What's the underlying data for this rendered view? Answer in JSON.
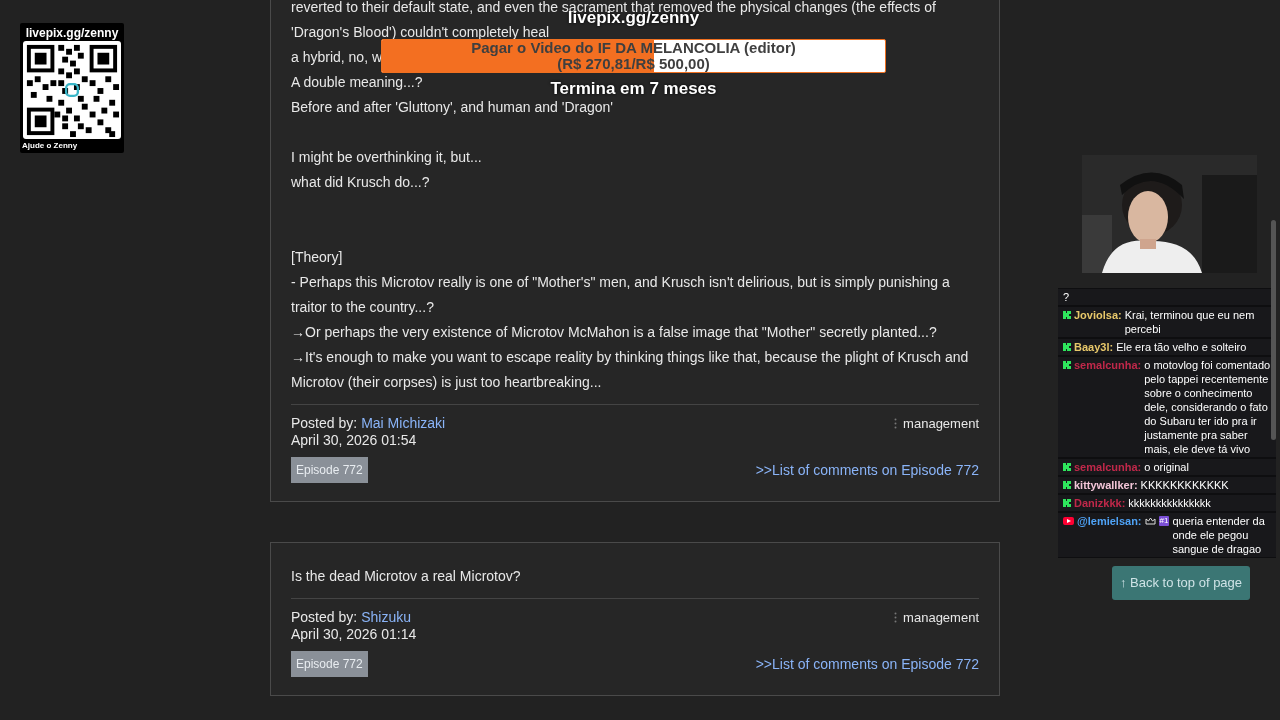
{
  "posts": [
    {
      "paragraphs": [
        {
          "kind": "lead",
          "lines": [
            "reverted to their default state, and even the sacrament that removed the physical changes (the effects of",
            "'Dragon's Blood') couldn't completely heal",
            "a hybrid, no, w",
            "A double meaning...?",
            "Before and after 'Gluttony', and human and 'Dragon'"
          ]
        },
        {
          "kind": "spaced",
          "lines": [
            "I might be overthinking it, but...",
            "what did Krusch do...?"
          ]
        },
        {
          "kind": "wide",
          "lines": [
            "[Theory]",
            "- Perhaps this Microtov really is one of \"Mother's\" men, and Krusch isn't delirious, but is simply punishing a",
            "traitor to the country...?",
            "→Or perhaps the very existence of Microtov McMahon is a false image that \"Mother\" secretly planted...?",
            "→It's enough to make you want to escape reality by thinking things like that, because the plight of Krusch and",
            "Microtov (their corpses) is just too heartbreaking..."
          ]
        }
      ],
      "posted_by_label": "Posted by:",
      "author": "Mai Michizaki",
      "date": "April 30, 2026 01:54",
      "management": "management",
      "episode_tag": "Episode 772",
      "comments_link": ">>List of comments on Episode 772"
    },
    {
      "paragraphs": [
        {
          "kind": "lead",
          "lines": [
            "Is the dead Microtov a real Microtov?"
          ]
        }
      ],
      "posted_by_label": "Posted by:",
      "author": "Shizuku",
      "date": "April 30, 2026 01:14",
      "management": "management",
      "episode_tag": "Episode 772",
      "comments_link": ">>List of comments on Episode 772"
    }
  ],
  "back_to_top": "↑ Back to top of page",
  "qr_card": {
    "url": "livepix.gg/zenny",
    "caption": "Ajude o Zenny"
  },
  "donation_goal": {
    "url": "livepix.gg/zenny",
    "title": "Pagar o Video do IF DA MELANCOLIA (editor)",
    "amount": "(R$ 270,81/R$ 500,00)",
    "level": 0.54,
    "ends": "Termina em 7 meses"
  },
  "chat": [
    {
      "kind": "partial",
      "text": "?"
    },
    {
      "kind": "twitch",
      "user": "Joviolsa:",
      "color": "#e8c86a",
      "text": "Krai, terminou que eu nem percebi"
    },
    {
      "kind": "twitch",
      "user": "Baay3l:",
      "color": "#e8c86a",
      "text": "Ele era tão velho e solteiro"
    },
    {
      "kind": "twitch",
      "user": "semalcunha:",
      "color": "#c0284a",
      "text": "o motovlog foi comentado pelo tappei recentemente sobre o conhecimento dele, considerando o fato do Subaru ter ido pra ir justamente pra saber mais, ele deve tá vivo"
    },
    {
      "kind": "twitch",
      "user": "semalcunha:",
      "color": "#c0284a",
      "text": "o original"
    },
    {
      "kind": "twitch",
      "user": "kittywallker:",
      "color": "#f3c6d8",
      "text": "KKKKKKKKKKKK"
    },
    {
      "kind": "twitch",
      "user": "Danizkkk:",
      "color": "#c0284a",
      "text": "kkkkkkkkkkkkkkk"
    },
    {
      "kind": "youtube",
      "user": "@lemielsan:",
      "color": "#4fa3f7",
      "badge": "#1",
      "text": "queria entender da onde ele pegou sangue de dragao"
    }
  ]
}
